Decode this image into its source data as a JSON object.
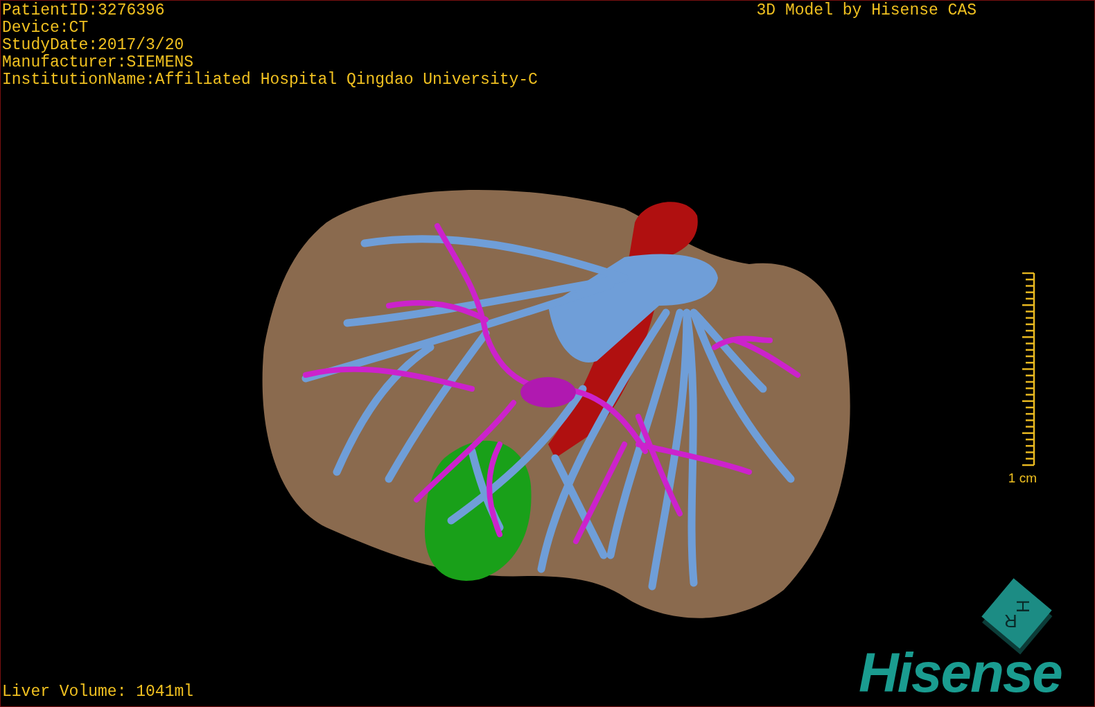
{
  "header": {
    "lines": [
      "PatientID:3276396",
      "Device:CT",
      "StudyDate:2017/3/20",
      "Manufacturer:SIEMENS",
      "InstitutionName:Affiliated Hospital Qingdao University-C"
    ]
  },
  "credit": "3D Model by Hisense CAS",
  "scale": {
    "label": "1 cm"
  },
  "liver_volume": "Liver Volume: 1041ml",
  "orientation_cube": {
    "labels": [
      "H",
      "R"
    ]
  },
  "logo": "Hisense"
}
